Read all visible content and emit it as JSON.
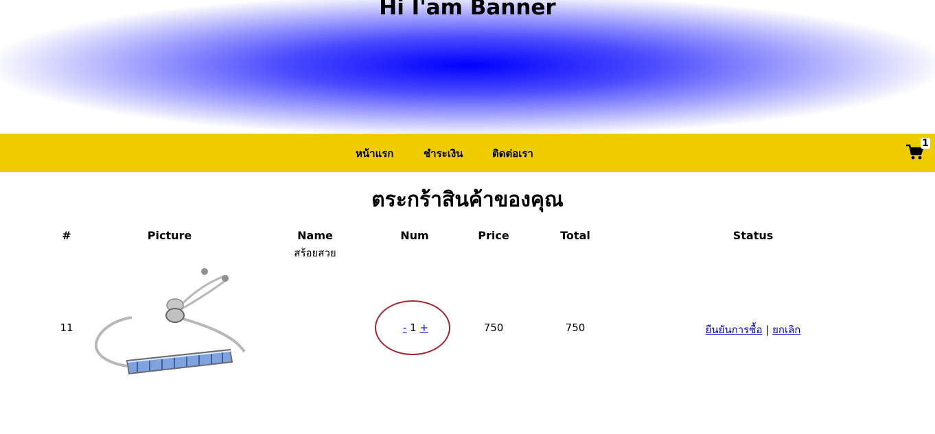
{
  "banner": {
    "title": "Hi I'am Banner"
  },
  "nav": {
    "items": [
      {
        "label": "หน้าแรก"
      },
      {
        "label": "ชำระเงิน"
      },
      {
        "label": "ติดต่อเรา"
      }
    ],
    "cart_icon": "shopping-cart-icon",
    "cart_count": "1"
  },
  "page": {
    "heading": "ตระกร้าสินค้าของคุณ"
  },
  "table": {
    "headers": [
      "#",
      "Picture",
      "Name",
      "Num",
      "Price",
      "Total",
      "Status"
    ],
    "rows": [
      {
        "id": "11",
        "name": "สร้อยสวย",
        "picture_icon": "bracelet-image",
        "decrement": "-",
        "num": "1",
        "increment": "+",
        "price": "750",
        "total": "750",
        "confirm": "ยืนยันการซื้อ",
        "separator": "|",
        "cancel": "ยกเลิก"
      }
    ]
  },
  "colors": {
    "nav_bg": "#eecc00",
    "banner_center": "#0000ff",
    "annotation_circle": "#a8232d",
    "link": "#0000cc"
  }
}
